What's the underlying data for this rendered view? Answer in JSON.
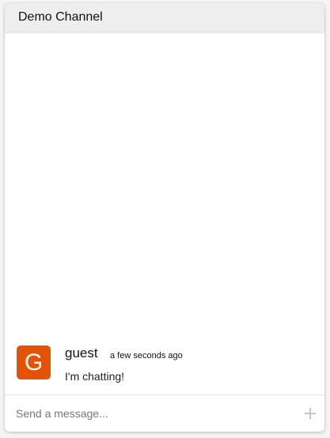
{
  "channel": {
    "title": "Demo Channel"
  },
  "messages": [
    {
      "avatar_letter": "G",
      "avatar_color": "#e35205",
      "username": "guest",
      "timestamp": "a few seconds ago",
      "text": "I'm chatting!"
    }
  ],
  "composer": {
    "placeholder": "Send a message...",
    "value": "",
    "attach_icon": "plus-icon"
  }
}
